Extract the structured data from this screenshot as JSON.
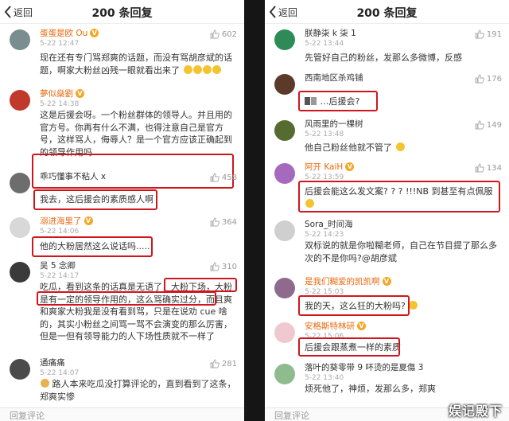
{
  "left": {
    "back_label": "返回",
    "title": "200 条回复",
    "reply_placeholder": "回复评论",
    "comments": [
      {
        "name": "蛋蛋是欧 Ou",
        "time": "5-22 12:47",
        "likes": "602",
        "text": "现在还有专门骂郑爽的话题，而没有骂胡彦斌的话题，啊家大粉丝凶残一眼就看出来了"
      },
      {
        "name": "夢似燊劉",
        "time": "5-22 14:38",
        "likes": "",
        "text": "这是后援会呀。一个粉丝群体的领导人。并且用的官方号。你再有什么不满，也得注意自己是官方号，这样骂人，侮辱人？是一个官方应该正确起到的领导作用吗"
      },
      {
        "name": "乖巧懂事不粘人 x",
        "time": "",
        "likes": "458",
        "text": "我去，这后援会的素质感人啊"
      },
      {
        "name": "溺进海里了",
        "time": "5-22 14:06",
        "likes": "364",
        "text": "他的大粉居然这么说话吗....."
      },
      {
        "name": "吴 5 念卿",
        "time": "5-22 14:17",
        "likes": "310",
        "text": "吃瓜，看到这条的话真是无语了，大粉下场，大粉是有一定的领导作用的，这么骂确实过分，而且爽和爽家大粉我是没有看到骂，只是在说劝 cue 啥的，其实小粉丝之间骂一骂不会演变的那么厉害，但是一但有领导能力的人下场性质就不一样了"
      },
      {
        "name": "通痛痛",
        "time": "5-22 14:07",
        "likes": "281",
        "text": "路人本来吃瓜没打算评论的，直到看到了这条，郑爽实惨"
      }
    ]
  },
  "right": {
    "back_label": "返回",
    "title": "200 条回复",
    "reply_placeholder": "回复评论",
    "watermark": "娱记殿下",
    "comments": [
      {
        "name": "朕静柒 k 柒 1",
        "time": "5-22 13:44",
        "likes": "191",
        "text": "先管好自己的粉丝，发那么多微博，反感"
      },
      {
        "name": "西南地区杀鸡铺",
        "time": "",
        "likes": "176",
        "text": "…后援会?"
      },
      {
        "name": "风雨里的一棵树",
        "time": "5-22 13:48",
        "likes": "149",
        "text": "他自己粉丝他就不管了"
      },
      {
        "name": "阿开 KaiH",
        "time": "5-22 13:59",
        "likes": "134",
        "text": "后援会能这么发文案? ? ? !!!NB 到甚至有点佩服"
      },
      {
        "name": "Sora_时间海",
        "time": "5-22 14:23",
        "likes": "",
        "text": "双标说的就是你啦糊老师，自己在节目提了那么多次的不是你吗?@胡彦斌"
      },
      {
        "name": "是我们糊爱的凯凯啊",
        "time": "5-22 15:03",
        "likes": "",
        "text": "我的天，这么狂的大粉吗?"
      },
      {
        "name": "安格斯特林研",
        "time": "5-22 15:06",
        "likes": "",
        "text": "后援会跟蒸煮一样的素质"
      },
      {
        "name": "落叶的葵零带 9 吥烫的是夏傷 3",
        "time": "5-22 13:40",
        "likes": "",
        "text": "烦死他了，神烦，发那么多，郑爽"
      }
    ]
  }
}
